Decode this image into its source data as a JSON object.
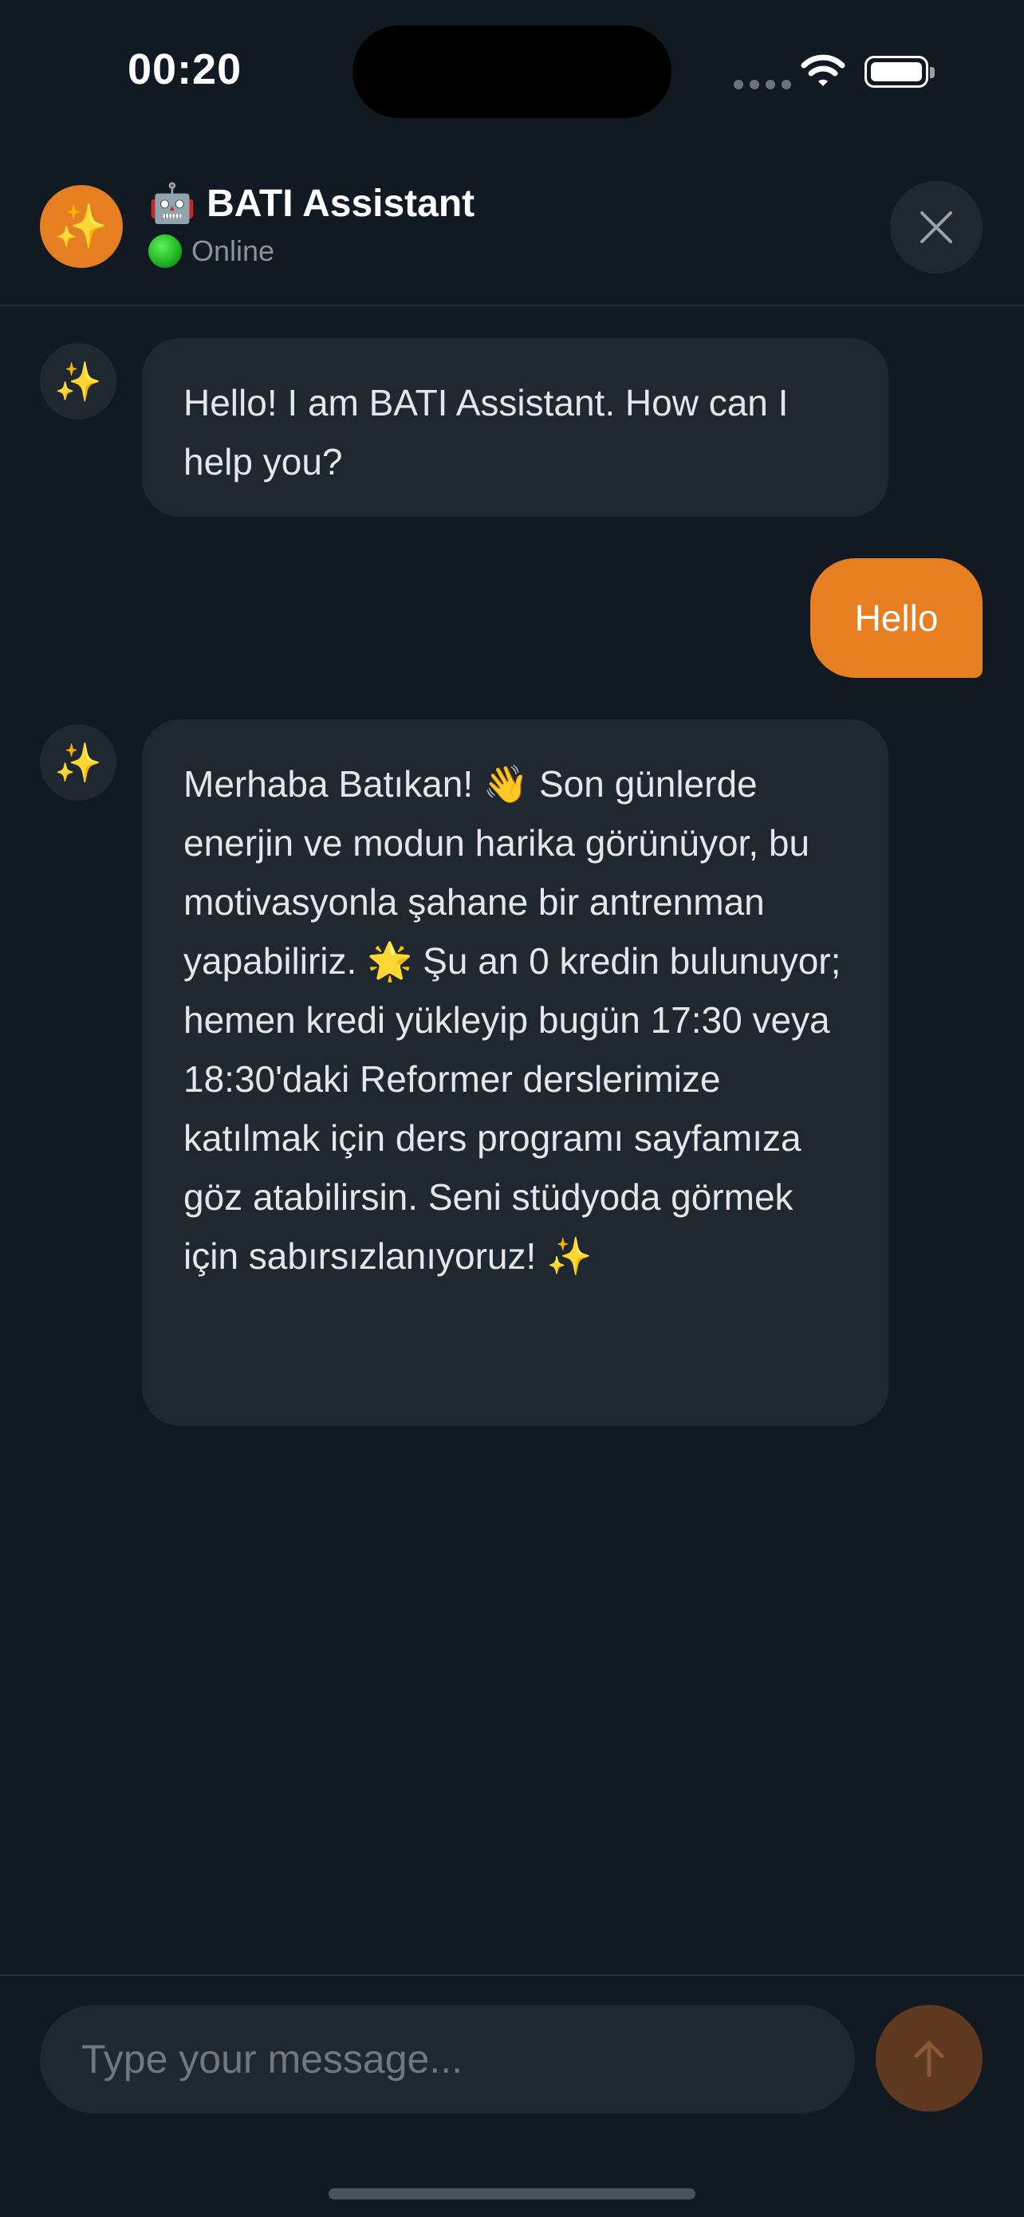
{
  "status_bar": {
    "time": "00:20"
  },
  "header": {
    "avatar_emoji": "✨",
    "title": "🤖 BATI Assistant",
    "status": "Online",
    "close_icon": "close-icon"
  },
  "messages": [
    {
      "sender": "bot",
      "avatar_emoji": "✨",
      "text": "Hello! I am BATI Assistant. How can I help you?"
    },
    {
      "sender": "user",
      "text": "Hello"
    },
    {
      "sender": "bot",
      "avatar_emoji": "✨",
      "text": "Merhaba Batıkan! 👋 Son günlerde enerjin ve modun harika görünüyor, bu motivasyonla şahane bir antrenman yapabiliriz. 🌟 Şu an 0 kredin bulunuyor; hemen kredi yükleyip bugün 17:30 veya 18:30'daki Reformer derslerimize katılmak için ders programı sayfamıza göz atabilirsin. Seni stüdyoda görmek için sabırsızlanıyoruz! ✨"
    }
  ],
  "composer": {
    "placeholder": "Type your message...",
    "send_icon": "arrow-up-icon"
  },
  "colors": {
    "background": "#111922",
    "accent": "#e67e22",
    "bubble_bot": "#1f2731",
    "online": "#17a417"
  }
}
